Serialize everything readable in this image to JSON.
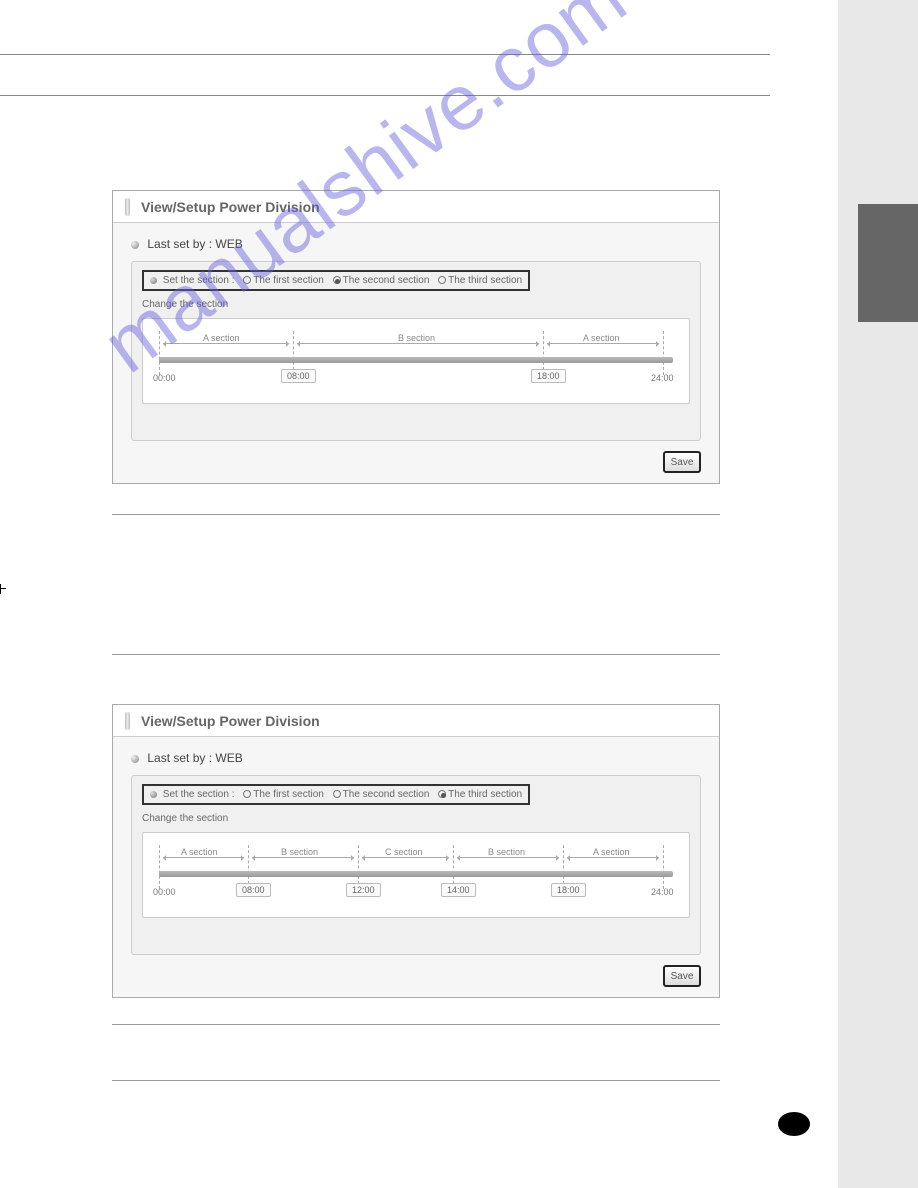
{
  "watermark": "manualshive.com",
  "panels": {
    "p1": {
      "title": "View/Setup Power Division",
      "last_set_prefix": "Last set by  : ",
      "last_set_value": "WEB",
      "section_label": "Set the section :",
      "opt1": "The first section",
      "opt2": "The second section",
      "opt3": "The third section",
      "checked": 2,
      "change_label": "Change the section",
      "save": "Save",
      "timeline": {
        "sec_a1": "A section",
        "sec_b": "B section",
        "sec_a2": "A section",
        "t0": "00:00",
        "t1": "08:00",
        "t2": "18:00",
        "t3": "24:00"
      }
    },
    "p2": {
      "title": "View/Setup Power Division",
      "last_set_prefix": "Last set by  : ",
      "last_set_value": "WEB",
      "section_label": "Set the section :",
      "opt1": "The first section",
      "opt2": "The second section",
      "opt3": "The third section",
      "checked": 3,
      "change_label": "Change the section",
      "save": "Save",
      "timeline": {
        "sec_a1": "A section",
        "sec_b1": "B section",
        "sec_c": "C section",
        "sec_b2": "B section",
        "sec_a2": "A section",
        "t0": "00:00",
        "t1": "08:00",
        "t2": "12:00",
        "t3": "14:00",
        "t4": "18:00",
        "t5": "24:00"
      }
    }
  }
}
